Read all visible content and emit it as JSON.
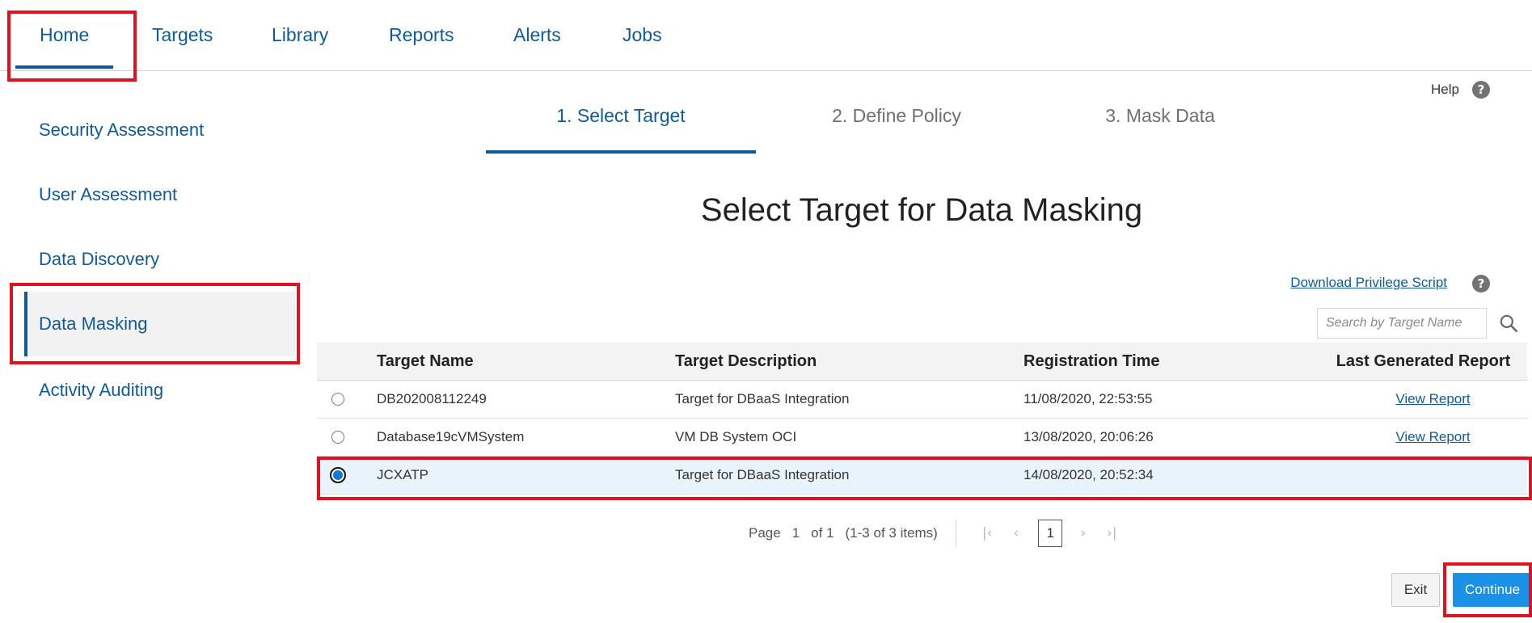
{
  "topnav": {
    "items": [
      {
        "label": "Home",
        "active": true
      },
      {
        "label": "Targets",
        "active": false
      },
      {
        "label": "Library",
        "active": false
      },
      {
        "label": "Reports",
        "active": false
      },
      {
        "label": "Alerts",
        "active": false
      },
      {
        "label": "Jobs",
        "active": false
      }
    ]
  },
  "help": {
    "label": "Help",
    "icon": "question-circle-icon"
  },
  "sidebar": {
    "items": [
      {
        "label": "Security Assessment",
        "active": false
      },
      {
        "label": "User Assessment",
        "active": false
      },
      {
        "label": "Data Discovery",
        "active": false
      },
      {
        "label": "Data Masking",
        "active": true
      },
      {
        "label": "Activity Auditing",
        "active": false
      }
    ]
  },
  "steps": [
    {
      "label": "1. Select Target",
      "active": true
    },
    {
      "label": "2. Define Policy",
      "active": false
    },
    {
      "label": "3. Mask Data",
      "active": false
    }
  ],
  "main": {
    "heading": "Select Target for Data Masking",
    "download_link": "Download Privilege Script",
    "search": {
      "placeholder": "Search by Target Name",
      "value": "",
      "icon": "search-icon"
    }
  },
  "table": {
    "columns": [
      "Target Name",
      "Target Description",
      "Registration Time",
      "Last Generated Report"
    ],
    "rows": [
      {
        "name": "DB202008112249",
        "description": "Target for DBaaS Integration",
        "time": "11/08/2020, 22:53:55",
        "report": "View Report",
        "selected": false
      },
      {
        "name": "Database19cVMSystem",
        "description": "VM DB System OCI",
        "time": "13/08/2020, 20:06:26",
        "report": "View Report",
        "selected": false
      },
      {
        "name": "JCXATP",
        "description": "Target for DBaaS Integration",
        "time": "14/08/2020, 20:52:34",
        "report": "",
        "selected": true
      }
    ]
  },
  "pagination": {
    "page_label": "Page",
    "current_page": "1",
    "of_label": "of 1",
    "items_label": "(1-3 of 3 items)",
    "page_box": "1"
  },
  "buttons": {
    "exit": "Exit",
    "continue": "Continue"
  },
  "colors": {
    "accent": "#0f5a9c",
    "primary_button": "#1a91e6",
    "highlight": "#e1121f",
    "selected_row": "#e9f3fb"
  }
}
